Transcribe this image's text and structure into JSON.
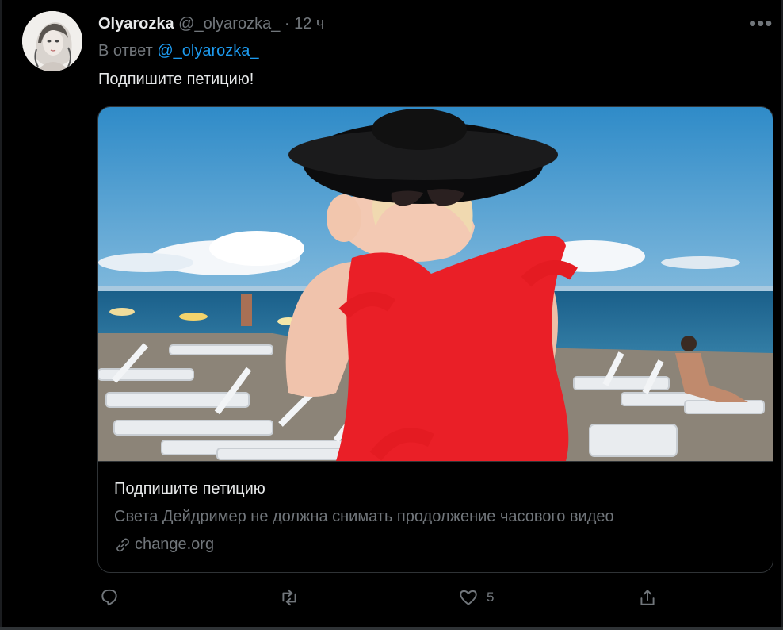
{
  "tweet": {
    "display_name": "Olyarozka",
    "handle": "@_olyarozka_",
    "separator": "·",
    "time": "12 ч",
    "more_icon": "more-horizontal-icon",
    "reply_prefix": "В ответ",
    "reply_mention": "@_olyarozka_",
    "text": "Подпишите петицию!"
  },
  "card": {
    "title": "Подпишите петицию",
    "description": "Света Дейдример не должна снимать продолжение часового видео",
    "domain": "change.org",
    "link_icon": "link-icon"
  },
  "actions": {
    "reply_icon": "reply-icon",
    "retweet_icon": "retweet-icon",
    "like_icon": "heart-icon",
    "like_count": "5",
    "share_icon": "share-icon"
  },
  "colors": {
    "background": "#000000",
    "text": "#e7e9ea",
    "muted": "#71767b",
    "accent": "#1d9bf0",
    "border": "#2f3336"
  }
}
